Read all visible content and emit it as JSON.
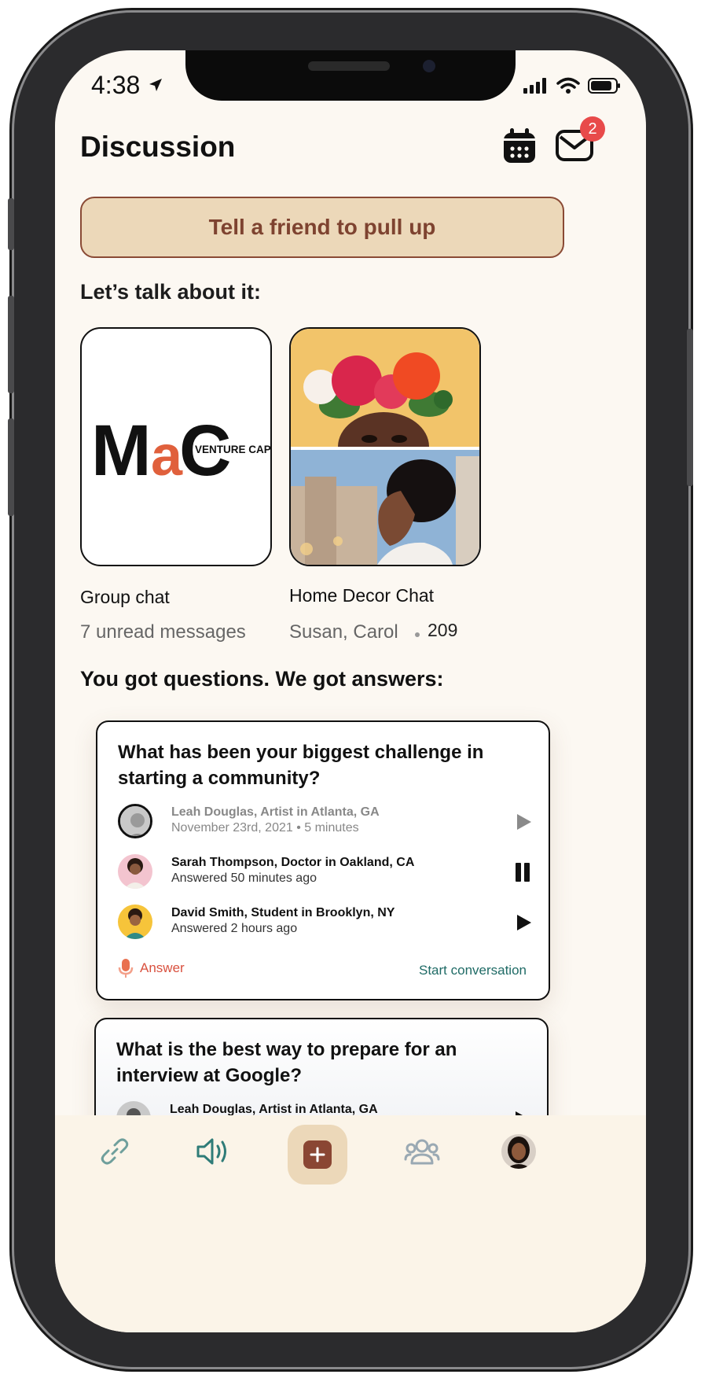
{
  "status_bar": {
    "time": "4:38"
  },
  "header": {
    "title": "Discussion",
    "mail_badge_count": "2"
  },
  "invite_button_label": "Tell a friend to pull up",
  "talk_section": {
    "title": "Let’s talk about it:",
    "chats": [
      {
        "name": "Group chat",
        "subtitle": "7 unread messages",
        "logo_text_main": "MaC",
        "logo_text_sub": "VENTURE CAPITAL"
      },
      {
        "name": "Home Decor Chat",
        "subtitle": "Susan, Carol",
        "count": "209"
      }
    ]
  },
  "qa_section": {
    "title": "You got questions. We got answers:",
    "questions": [
      {
        "text": "What has been your biggest challenge in starting a community?",
        "answers": [
          {
            "name": "Leah Douglas, Artist in Atlanta, GA",
            "meta": "November 23rd, 2021 • 5 minutes",
            "control": "play-muted"
          },
          {
            "name": "Sarah Thompson, Doctor in Oakland, CA",
            "meta": "Answered 50 minutes ago",
            "control": "pause"
          },
          {
            "name": "David Smith, Student in Brooklyn, NY",
            "meta": "Answered 2 hours ago",
            "control": "play"
          }
        ],
        "answer_label": "Answer",
        "start_label": "Start conversation"
      },
      {
        "text": "What is the best way to prepare for an interview at Google?",
        "answers": [
          {
            "name": "Leah Douglas, Artist in Atlanta, GA"
          }
        ]
      }
    ]
  },
  "tab_bar": {
    "items": [
      "link-icon",
      "audio-icon",
      "create-icon",
      "people-icon",
      "profile-avatar"
    ]
  },
  "colors": {
    "accent_brown": "#8a4633",
    "invite_bg": "#ecd8b9",
    "answer_red": "#d9513f",
    "link_teal": "#1f6b66",
    "badge_red": "#e84a4a"
  }
}
